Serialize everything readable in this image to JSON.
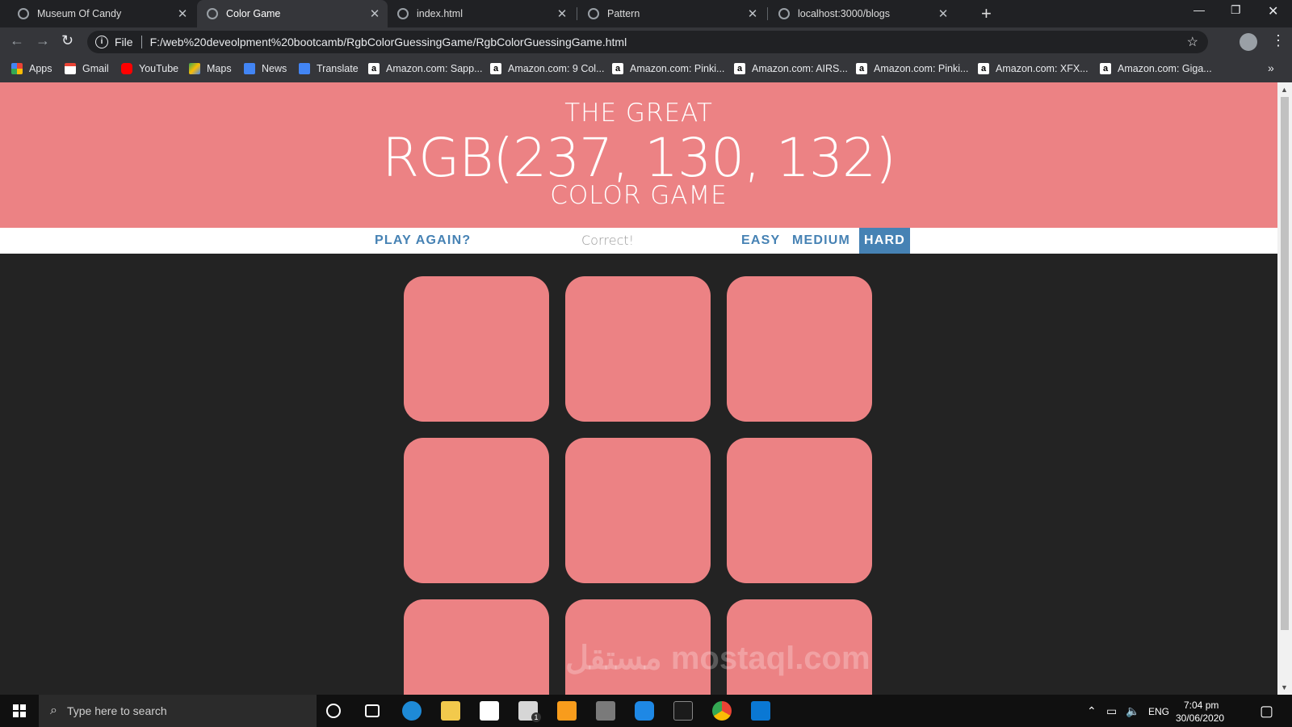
{
  "browser": {
    "tabs": [
      {
        "label": "Museum Of Candy",
        "active": false
      },
      {
        "label": "Color Game",
        "active": true
      },
      {
        "label": "index.html",
        "active": false
      },
      {
        "label": "Pattern",
        "active": false
      },
      {
        "label": "localhost:3000/blogs",
        "active": false
      }
    ],
    "new_tab": "+",
    "address_prefix": "File",
    "address": "F:/web%20deveolpment%20bootcamb/RgbColorGuessingGame/RgbColorGuessingGame.html",
    "bookmarks": [
      {
        "label": "Apps",
        "icon": "apps-grid-icon",
        "color": "#ea4335"
      },
      {
        "label": "Gmail",
        "icon": "gmail-icon",
        "color": "#ea4335"
      },
      {
        "label": "YouTube",
        "icon": "youtube-icon",
        "color": "#ff0000"
      },
      {
        "label": "Maps",
        "icon": "maps-icon",
        "color": "#34a853"
      },
      {
        "label": "News",
        "icon": "news-icon",
        "color": "#4285f4"
      },
      {
        "label": "Translate",
        "icon": "translate-icon",
        "color": "#4285f4"
      },
      {
        "label": "Amazon.com: Sapp...",
        "icon": "amazon-icon"
      },
      {
        "label": "Amazon.com: 9 Col...",
        "icon": "amazon-icon"
      },
      {
        "label": "Amazon.com: Pinki...",
        "icon": "amazon-icon"
      },
      {
        "label": "Amazon.com: AIRS...",
        "icon": "amazon-icon"
      },
      {
        "label": "Amazon.com: Pinki...",
        "icon": "amazon-icon"
      },
      {
        "label": "Amazon.com: XFX...",
        "icon": "amazon-icon"
      },
      {
        "label": "Amazon.com: Giga...",
        "icon": "amazon-icon"
      }
    ],
    "bookmarks_more": "»"
  },
  "game": {
    "header_top": "THE GREAT",
    "rgb_display": "RGB(237, 130, 132)",
    "header_bottom": "COLOR GAME",
    "header_color": "#ec8284",
    "play_again": "PLAY AGAIN?",
    "message": "Correct!",
    "modes": [
      {
        "label": "EASY",
        "selected": false
      },
      {
        "label": "MEDIUM",
        "selected": false
      },
      {
        "label": "HARD",
        "selected": true
      }
    ],
    "squares": [
      "#ec8284",
      "#ec8284",
      "#ec8284",
      "#ec8284",
      "#ec8284",
      "#ec8284",
      "#ec8284",
      "#ec8284",
      "#ec8284"
    ]
  },
  "watermark": "مستقل mostaql.com",
  "taskbar": {
    "search_placeholder": "Type here to search",
    "language": "ENG",
    "time": "7:04 pm",
    "date": "30/06/2020",
    "mail_badge": "1"
  }
}
